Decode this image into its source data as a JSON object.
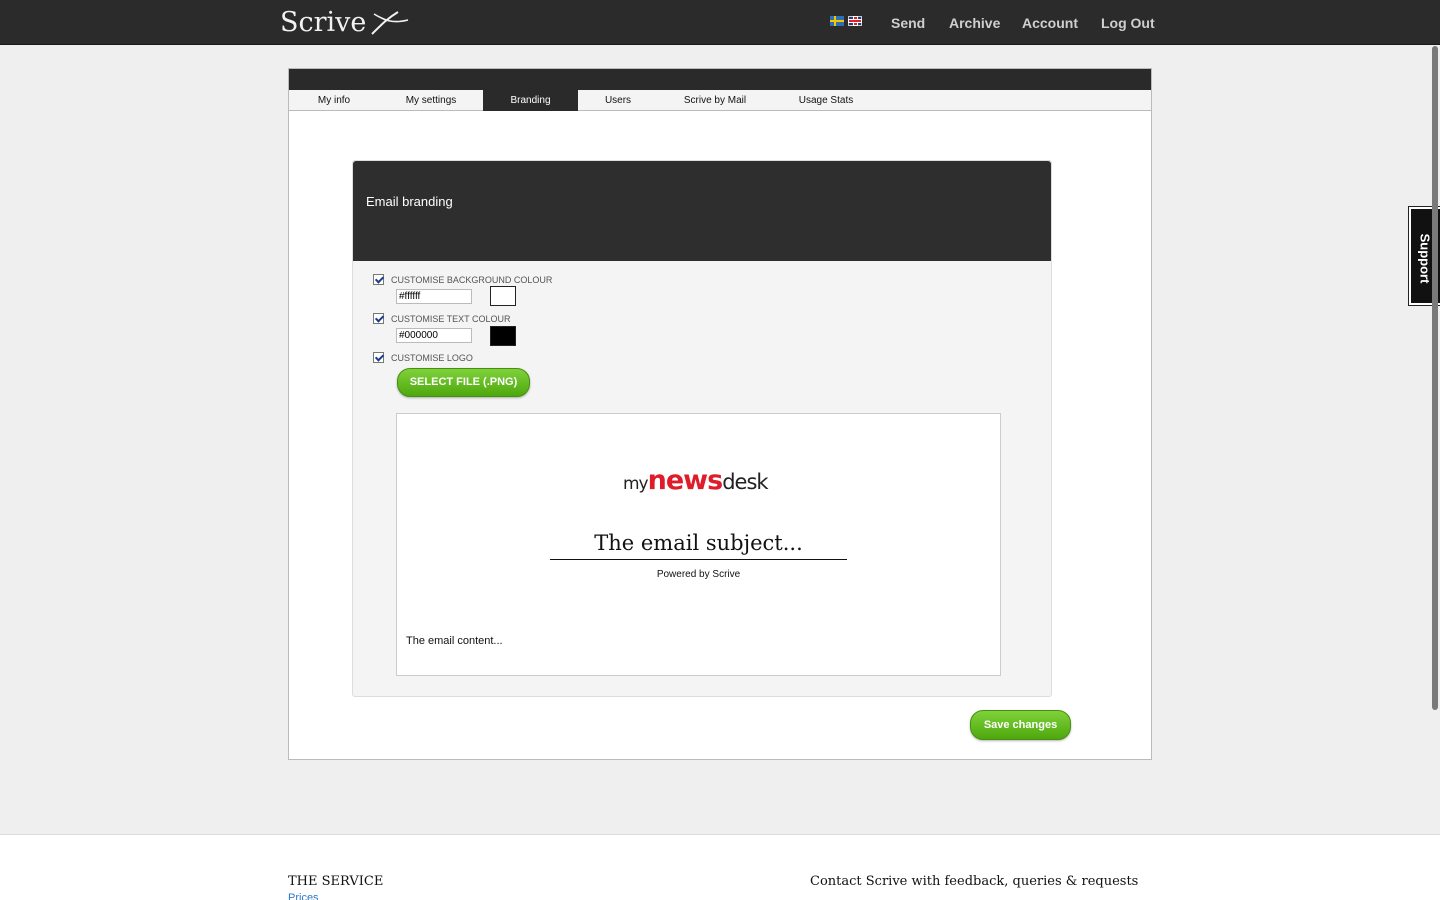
{
  "header": {
    "logo_text": "Scrive",
    "nav": [
      "Send",
      "Archive",
      "Account",
      "Log Out"
    ]
  },
  "tabs": [
    "My info",
    "My settings",
    "Branding",
    "Users",
    "Scrive by Mail",
    "Usage Stats"
  ],
  "active_tab": "Branding",
  "branding": {
    "title": "Email branding",
    "bg_label": "CUSTOMISE BACKGROUND COLOUR",
    "bg_value": "#ffffff",
    "text_label": "CUSTOMISE TEXT COLOUR",
    "text_value": "#000000",
    "logo_label": "CUSTOMISE LOGO",
    "select_file": "SELECT FILE (.PNG)"
  },
  "preview": {
    "logo_my": "my",
    "logo_news": "news",
    "logo_desk": "desk",
    "subject": "The email subject...",
    "powered": "Powered by Scrive",
    "content": "The email content..."
  },
  "save_label": "Save changes",
  "support_label": "Support",
  "footer": {
    "service_heading": "THE SERVICE",
    "prices_link": "Prices",
    "contact_heading": "Contact Scrive with feedback, queries & requests"
  },
  "colors": {
    "accent_green": "#5cb81a",
    "header_dark": "#2b2b2b",
    "news_red": "#e01b2a"
  }
}
